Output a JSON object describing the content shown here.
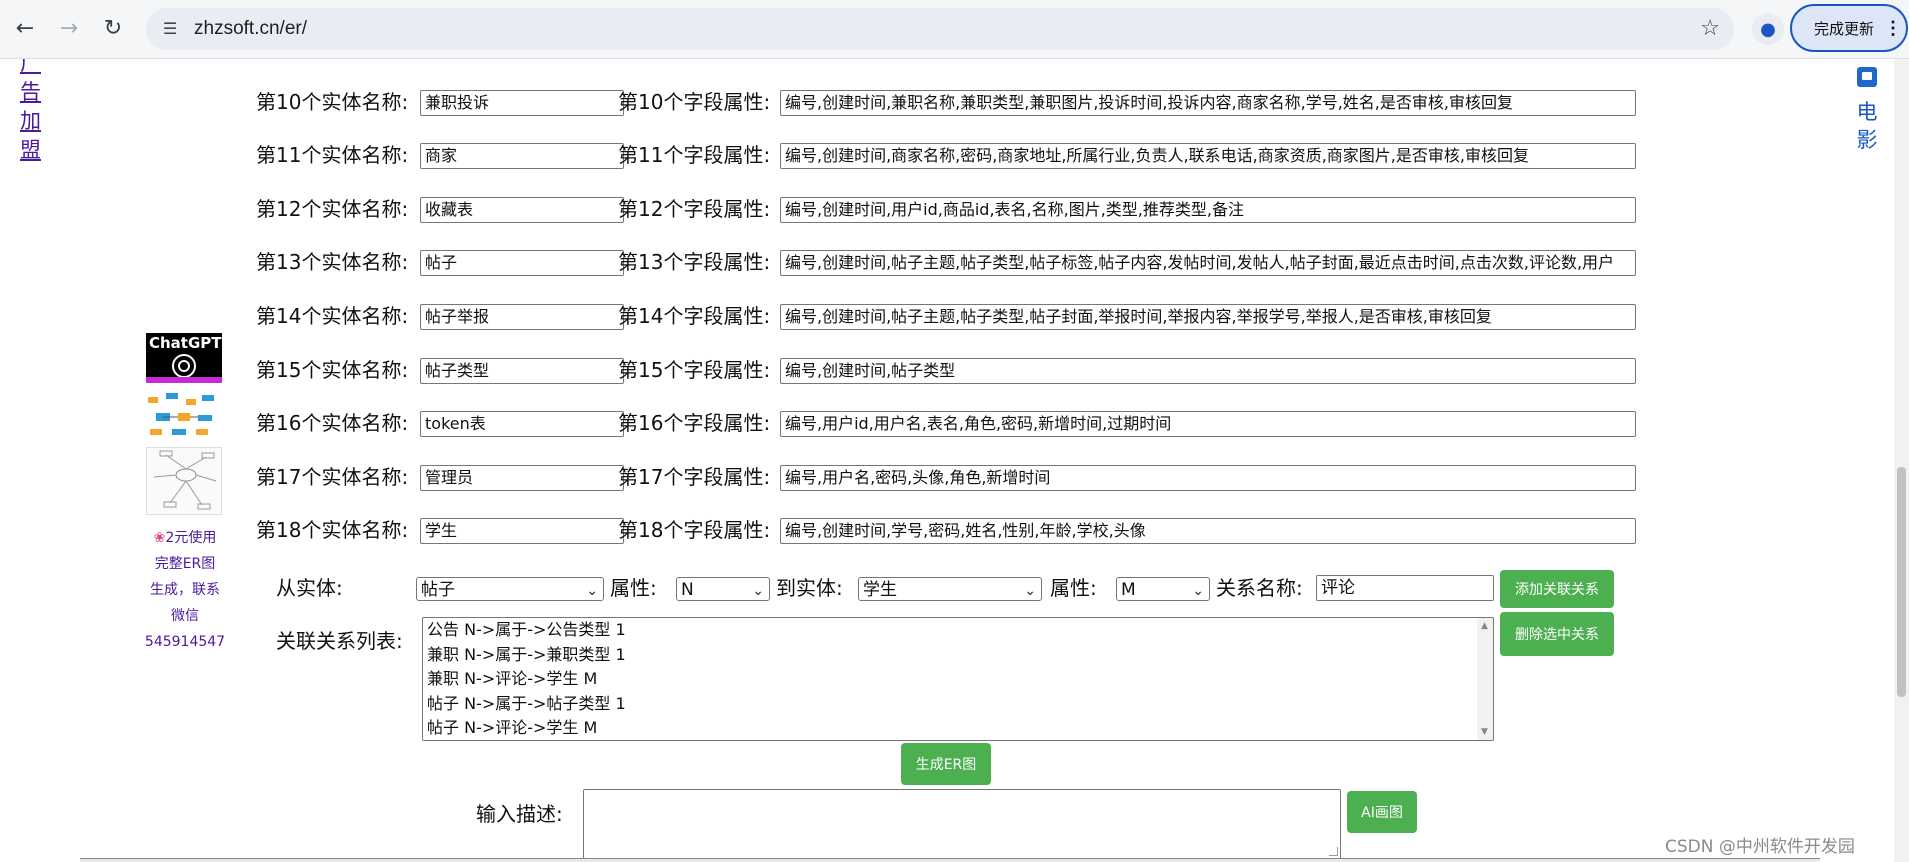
{
  "browser": {
    "url": "zhzsoft.cn/er/",
    "update_label": "完成更新",
    "update_menu": "⋮"
  },
  "left_link": "广告加盟",
  "right_link": "电影",
  "entities": [
    {
      "label1": "第10个实体名称:",
      "name": "兼职投诉",
      "label2": "第10个字段属性:",
      "fields": "编号,创建时间,兼职名称,兼职类型,兼职图片,投诉时间,投诉内容,商家名称,学号,姓名,是否审核,审核回复"
    },
    {
      "label1": "第11个实体名称:",
      "name": "商家",
      "label2": "第11个字段属性:",
      "fields": "编号,创建时间,商家名称,密码,商家地址,所属行业,负责人,联系电话,商家资质,商家图片,是否审核,审核回复"
    },
    {
      "label1": "第12个实体名称:",
      "name": "收藏表",
      "label2": "第12个字段属性:",
      "fields": "编号,创建时间,用户id,商品id,表名,名称,图片,类型,推荐类型,备注"
    },
    {
      "label1": "第13个实体名称:",
      "name": "帖子",
      "label2": "第13个字段属性:",
      "fields": "编号,创建时间,帖子主题,帖子类型,帖子标签,帖子内容,发帖时间,发帖人,帖子封面,最近点击时间,点击次数,评论数,用户"
    },
    {
      "label1": "第14个实体名称:",
      "name": "帖子举报",
      "label2": "第14个字段属性:",
      "fields": "编号,创建时间,帖子主题,帖子类型,帖子封面,举报时间,举报内容,举报学号,举报人,是否审核,审核回复"
    },
    {
      "label1": "第15个实体名称:",
      "name": "帖子类型",
      "label2": "第15个字段属性:",
      "fields": "编号,创建时间,帖子类型"
    },
    {
      "label1": "第16个实体名称:",
      "name": "token表",
      "label2": "第16个字段属性:",
      "fields": "编号,用户id,用户名,表名,角色,密码,新增时间,过期时间"
    },
    {
      "label1": "第17个实体名称:",
      "name": "管理员",
      "label2": "第17个字段属性:",
      "fields": "编号,用户名,密码,头像,角色,新增时间"
    },
    {
      "label1": "第18个实体名称:",
      "name": "学生",
      "label2": "第18个字段属性:",
      "fields": "编号,创建时间,学号,密码,姓名,性别,年龄,学校,头像"
    }
  ],
  "side_promo": {
    "chatgpt_logo_text": "ChatGPT",
    "text_line1": "2元使用",
    "text_line2": "完整ER图",
    "text_line3": "生成，联系",
    "text_line4": "微信",
    "text_line5": "545914547"
  },
  "relation": {
    "from_label": "从实体:",
    "from_value": "帖子",
    "attr_label": "属性:",
    "from_attr": "N",
    "to_label": "到实体:",
    "to_value": "学生",
    "attr2_label": "属性:",
    "to_attr": "M",
    "name_label": "关系名称:",
    "name_value": "评论",
    "add_button": "添加关联关系",
    "delete_button": "删除选中关系",
    "list_label": "关联关系列表:",
    "list_items": [
      "公告 N->属于->公告类型 1",
      "兼职 N->属于->兼职类型 1",
      "兼职 N->评论->学生 M",
      "帖子 N->属于->帖子类型 1",
      "帖子 N->评论->学生 M"
    ]
  },
  "generate_button": "生成ER图",
  "describe_label": "输入描述:",
  "ai_button": "AI画图",
  "watermark": "CSDN @中州软件开发园"
}
